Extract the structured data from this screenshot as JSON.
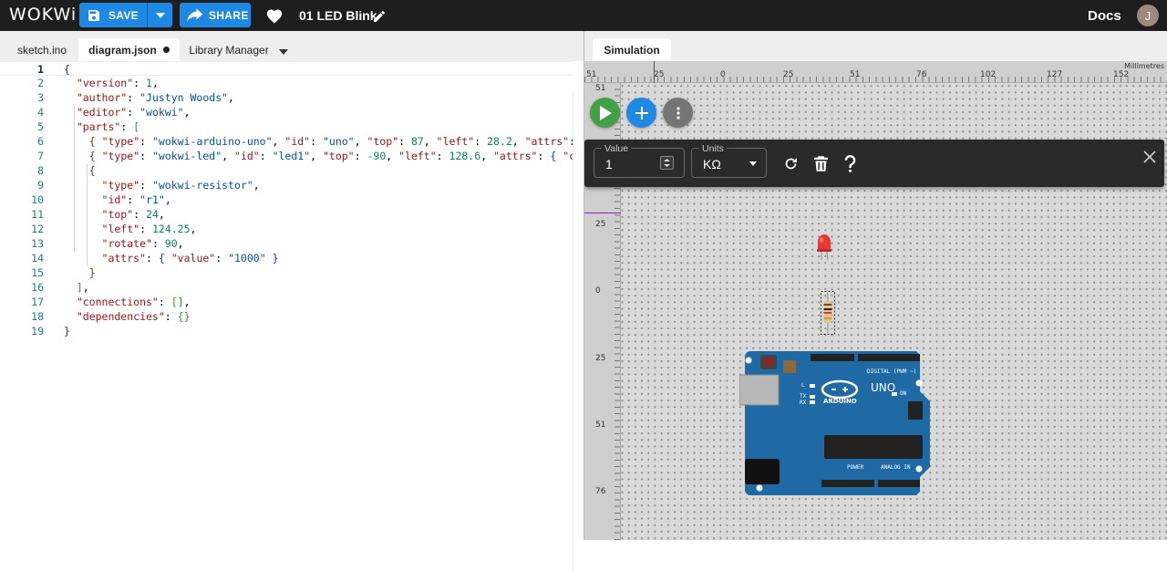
{
  "app": {
    "logo": "WOKWi",
    "project_name": "01 LED Blink",
    "save_label": "SAVE",
    "share_label": "SHARE",
    "docs_label": "Docs",
    "avatar_initial": "J"
  },
  "editor": {
    "tabs": [
      {
        "label": "sketch.ino",
        "active": false,
        "modified": false
      },
      {
        "label": "diagram.json",
        "active": true,
        "modified": true
      },
      {
        "label": "Library Manager",
        "active": false,
        "modified": false
      }
    ],
    "current_line": 1,
    "lines": [
      "{",
      "  \"version\": 1,",
      "  \"author\": \"Justyn Woods\",",
      "  \"editor\": \"wokwi\",",
      "  \"parts\": [",
      "    { \"type\": \"wokwi-arduino-uno\", \"id\": \"uno\", \"top\": 87, \"left\": 28.2, \"attrs\": {} },",
      "    { \"type\": \"wokwi-led\", \"id\": \"led1\", \"top\": -90, \"left\": 128.6, \"attrs\": { \"color\": \"",
      "    {",
      "      \"type\": \"wokwi-resistor\",",
      "      \"id\": \"r1\",",
      "      \"top\": 24,",
      "      \"left\": 124.25,",
      "      \"rotate\": 90,",
      "      \"attrs\": { \"value\": \"1000\" }",
      "    }",
      "  ],",
      "  \"connections\": [],",
      "  \"dependencies\": {}",
      "}"
    ]
  },
  "simulation": {
    "tab_label": "Simulation",
    "ruler_unit": "Millimetres",
    "ruler_top_labels": [
      "51",
      "25",
      "0",
      "25",
      "51",
      "76",
      "102",
      "127",
      "152"
    ],
    "ruler_left_labels": [
      "25",
      "0",
      "25",
      "51",
      "76"
    ],
    "ruler_left_hidden_label": "51",
    "property_panel": {
      "value_label": "Value",
      "value": "1",
      "units_label": "Units",
      "units_value": "KΩ"
    },
    "board": {
      "model_label": "UNO",
      "brand_label": "ARDUINO",
      "digital_label": "DIGITAL (PWM ~)",
      "power_label": "POWER",
      "analog_label": "ANALOG IN",
      "on_label": "ON",
      "tx_label": "TX",
      "rx_label": "RX",
      "l_label": "L"
    },
    "colors": {
      "board": "#1f6aa5",
      "led": "#e53935",
      "play": "#43a047",
      "add": "#1e88e5"
    }
  }
}
